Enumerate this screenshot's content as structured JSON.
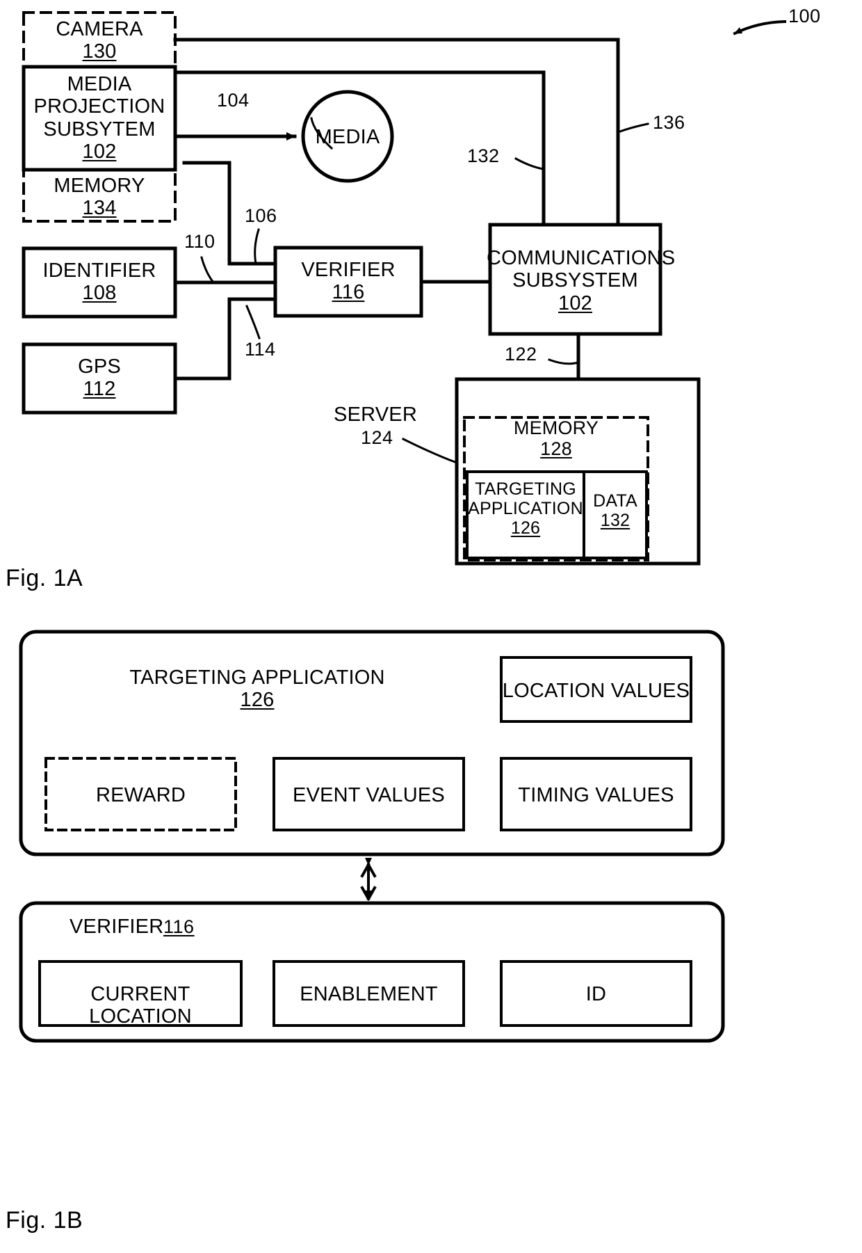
{
  "figure_a": {
    "caption": "Fig. 1A",
    "system_ref": "100",
    "blocks": {
      "camera": {
        "label": "CAMERA",
        "num": "130",
        "style": "dashed"
      },
      "media_projection_subsystem": {
        "label": "MEDIA\nPROJECTION\nSUBSYTEM",
        "num": "102",
        "style": "solid"
      },
      "memory_device": {
        "label": "MEMORY",
        "num": "134",
        "style": "dashed"
      },
      "media": {
        "label": "MEDIA",
        "shape": "circle"
      },
      "identifier": {
        "label": "IDENTIFIER",
        "num": "108",
        "style": "solid"
      },
      "gps": {
        "label": "GPS",
        "num": "112",
        "style": "solid"
      },
      "verifier": {
        "label": "VERIFIER",
        "num": "116",
        "style": "solid"
      },
      "communications_subsystem": {
        "label": "COMMUNICATIONS\nSUBSYSTEM",
        "num": "102",
        "style": "solid"
      },
      "server": {
        "label": "SERVER",
        "num": "124",
        "style": "solid"
      },
      "server_memory": {
        "label": "MEMORY",
        "num": "128",
        "style": "dashed"
      },
      "targeting_application": {
        "label": "TARGETING\nAPPLICATION",
        "num": "126",
        "style": "solid"
      },
      "data": {
        "label": "DATA",
        "num": "132",
        "style": "solid"
      }
    },
    "lead_lines": {
      "media_link": "104",
      "verifier_top_link": "106",
      "identifier_link": "110",
      "gps_link": "114",
      "communications_link": "132",
      "server_link": "122",
      "camera_link": "136"
    }
  },
  "figure_b": {
    "caption": "Fig. 1B",
    "targeting_application": {
      "label": "TARGETING APPLICATION",
      "num": "126",
      "items": [
        {
          "label": "LOCATION VALUES",
          "style": "solid"
        },
        {
          "label": "REWARD",
          "style": "dashed"
        },
        {
          "label": "EVENT VALUES",
          "style": "solid"
        },
        {
          "label": "TIMING VALUES",
          "style": "solid"
        }
      ]
    },
    "verifier": {
      "label": "VERIFIER",
      "num": "116",
      "items": [
        {
          "label": "CURRENT LOCATION",
          "style": "solid"
        },
        {
          "label": "ENABLEMENT",
          "style": "solid"
        },
        {
          "label": "ID",
          "style": "solid"
        }
      ]
    },
    "connector": "double-headed-arrow"
  },
  "colors": {
    "stroke": "#000000",
    "background": "#ffffff"
  }
}
